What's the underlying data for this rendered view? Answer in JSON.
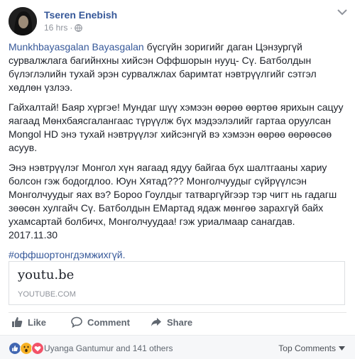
{
  "header": {
    "author": "Tseren Enebish",
    "timestamp": "16 hrs",
    "separator": "·",
    "privacy_icon": "globe-icon",
    "menu_icon": "chevron-down-icon"
  },
  "post": {
    "mention": "Munkhbayasgalan Bayasgalan",
    "paragraph1_rest": " бүсгүйн зоригийг даган Цэнзургүй сурвалжлага багийнхны хийсэн Оффшорын нууц- Сү. Батболдын бүлэглэлийн тухай эрэн сурвалжлах баримтат нэвтрүүлгийг сэтгэл хөдлөн үзлээ.",
    "paragraph2": "Гайхалтай! Баяр хүргэе! Мундаг шүү хэмээн өөрөө өөртөө ярихын сацуу яагаад Мөнхбаясгалангаас түрүүлж бүх мэдээлэлийг гартаа оруулсан Mongol HD энэ тухай нэвтрүүлэг хийсэнгүй вэ хэмээн өөрөө өөрөөсөө асуув.",
    "paragraph3": "Энэ нэвтрүүлэг Монгол хүн яагаад ядуу байгаа бүх шалтгааны хариу болсон гэж бодогдлоо. Юун Хятад??? Монголчуудыг сүйрүүлсэн Монголчуудыг яах вэ? Бороо Гоулдыг татваргүйгээр тэр чигт нь гадагш зөөсөн хулгайч Сү. Батболдын ЕМартад ядаж мөнгөө зарахгүй байх ухамсартай болбичх, Монголчуудаа! гэж уриалмаар санагдав.",
    "date": "2017.11.30",
    "hashtag": "#оффшортонгдэмжихгүй."
  },
  "link_card": {
    "title": "youtu.be",
    "domain": "YOUTUBE.COM"
  },
  "actions": {
    "like": "Like",
    "comment": "Comment",
    "share": "Share"
  },
  "footer": {
    "reactions_text": "Uyanga Gantumur and 141 others",
    "sort_label": "Top Comments",
    "reaction_icons": [
      "like-icon",
      "wow-icon",
      "love-icon"
    ]
  },
  "colors": {
    "link": "#365899",
    "like_blue": "#4267b2",
    "love_red": "#f25268",
    "wow_yellow": "#f7b125"
  }
}
